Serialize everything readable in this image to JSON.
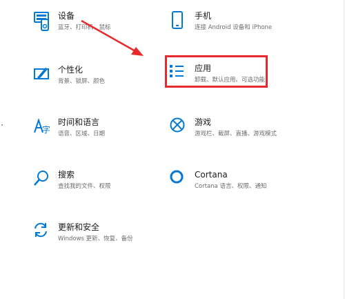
{
  "settings": {
    "tiles": [
      {
        "key": "devices",
        "title": "设备",
        "desc": "蓝牙、打印机、鼠标",
        "icon": "devices-icon"
      },
      {
        "key": "phone",
        "title": "手机",
        "desc": "连接 Android 设备和 iPhone",
        "icon": "phone-icon"
      },
      {
        "key": "personalization",
        "title": "个性化",
        "desc": "背景、锁屏、颜色",
        "icon": "personalization-icon"
      },
      {
        "key": "apps",
        "title": "应用",
        "desc": "卸载、默认应用、可选功能",
        "icon": "apps-icon"
      },
      {
        "key": "time-language",
        "title": "时间和语言",
        "desc": "语音、区域、日期",
        "icon": "time-language-icon"
      },
      {
        "key": "gaming",
        "title": "游戏",
        "desc": "游戏栏、截屏、直播、游戏模式",
        "icon": "xbox-icon"
      },
      {
        "key": "search",
        "title": "搜索",
        "desc": "查找我的文件、权限",
        "icon": "search-icon"
      },
      {
        "key": "cortana",
        "title": "Cortana",
        "desc": "Cortana 语言、权限、通知",
        "icon": "cortana-icon"
      },
      {
        "key": "update-security",
        "title": "更新和安全",
        "desc": "Windows 更新、恢复、备份",
        "icon": "update-icon"
      }
    ]
  },
  "colors": {
    "accent": "#0078d7",
    "highlight": "#e8282b",
    "title_text": "#1a1a1a",
    "desc_text": "#6b6b6b"
  }
}
